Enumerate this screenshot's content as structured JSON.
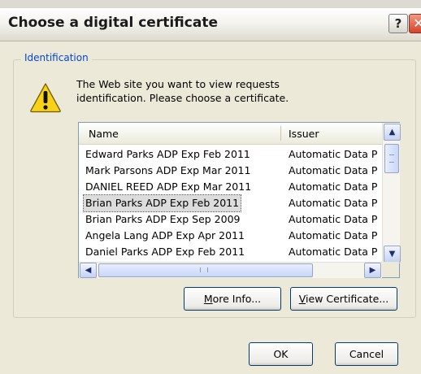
{
  "dialog": {
    "title": "Choose a digital certificate",
    "help_glyph": "?",
    "close_glyph": "✕"
  },
  "group": {
    "legend": "Identification",
    "message": "The Web site you want to view requests identification. Please choose a certificate."
  },
  "list": {
    "columns": [
      "Name",
      "Issuer"
    ],
    "rows": [
      {
        "name": "Edward Parks ADP Exp Feb 2011",
        "issuer": "Automatic Data P"
      },
      {
        "name": "Mark Parsons ADP Exp Mar 2011",
        "issuer": "Automatic Data P"
      },
      {
        "name": "DANIEL REED ADP Exp Mar 2011",
        "issuer": "Automatic Data P"
      },
      {
        "name": "Brian Parks ADP Exp Feb 2011",
        "issuer": "Automatic Data P",
        "selected": true
      },
      {
        "name": "Brian Parks ADP Exp Sep 2009",
        "issuer": "Automatic Data P"
      },
      {
        "name": "Angela Lang ADP Exp Apr 2011",
        "issuer": "Automatic Data P"
      },
      {
        "name": "Daniel Parks ADP Exp Feb 2011",
        "issuer": "Automatic Data P"
      }
    ]
  },
  "buttons": {
    "more_info": {
      "mnemonic": "M",
      "rest": "ore Info..."
    },
    "view_certificate": {
      "mnemonic": "V",
      "rest": "iew Certificate..."
    },
    "ok": "OK",
    "cancel": "Cancel"
  },
  "icons": [
    "warning-icon",
    "help-icon",
    "close-icon",
    "scroll-up-icon",
    "scroll-down-icon",
    "scroll-left-icon",
    "scroll-right-icon"
  ]
}
